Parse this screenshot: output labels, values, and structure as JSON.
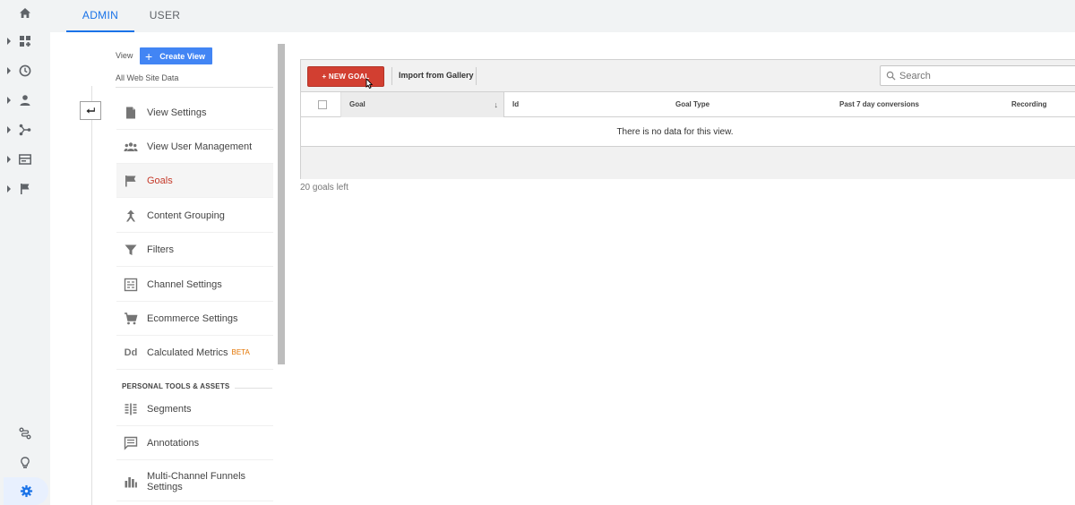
{
  "top_tabs": {
    "admin": "ADMIN",
    "user": "USER"
  },
  "rail": {
    "items": [
      "home-icon",
      "dashboard-icon",
      "realtime-clock-icon",
      "audience-person-icon",
      "acquisition-icon",
      "behavior-icon",
      "conversions-flag-icon"
    ],
    "bottom": [
      "discover-icon",
      "lightbulb-icon",
      "admin-gear-icon"
    ]
  },
  "view": {
    "label": "View",
    "create_button": "Create View",
    "name": "All Web Site Data"
  },
  "nav": {
    "items": [
      {
        "label": "View Settings",
        "icon": "document-icon"
      },
      {
        "label": "View User Management",
        "icon": "people-icon"
      },
      {
        "label": "Goals",
        "icon": "flag-icon",
        "active": true
      },
      {
        "label": "Content Grouping",
        "icon": "grouping-icon"
      },
      {
        "label": "Filters",
        "icon": "filter-icon"
      },
      {
        "label": "Channel Settings",
        "icon": "channel-icon"
      },
      {
        "label": "Ecommerce Settings",
        "icon": "cart-icon"
      },
      {
        "label": "Calculated Metrics",
        "badge": "BETA",
        "icon": "dd-icon"
      }
    ],
    "personal_header": "PERSONAL TOOLS & ASSETS",
    "personal_items": [
      {
        "label": "Segments",
        "icon": "segments-icon"
      },
      {
        "label": "Annotations",
        "icon": "annotation-icon"
      },
      {
        "label_line1": "Multi-Channel Funnels",
        "label_line2": "Settings",
        "icon": "bar-chart-icon"
      }
    ]
  },
  "goals": {
    "new_goal_button": "+ NEW GOAL",
    "import_button": "Import from Gallery",
    "search_placeholder": "Search",
    "columns": {
      "goal": "Goal",
      "id": "Id",
      "goal_type": "Goal Type",
      "past_conversions": "Past 7 day conversions",
      "recording": "Recording"
    },
    "empty_message": "There is no data for this view.",
    "goals_left": "20 goals left"
  },
  "colors": {
    "accent_blue": "#1a73e8",
    "create_view_blue": "#4285f4",
    "new_goal_red": "#d23f31",
    "active_text": "#c53929",
    "beta_orange": "#e37400"
  }
}
